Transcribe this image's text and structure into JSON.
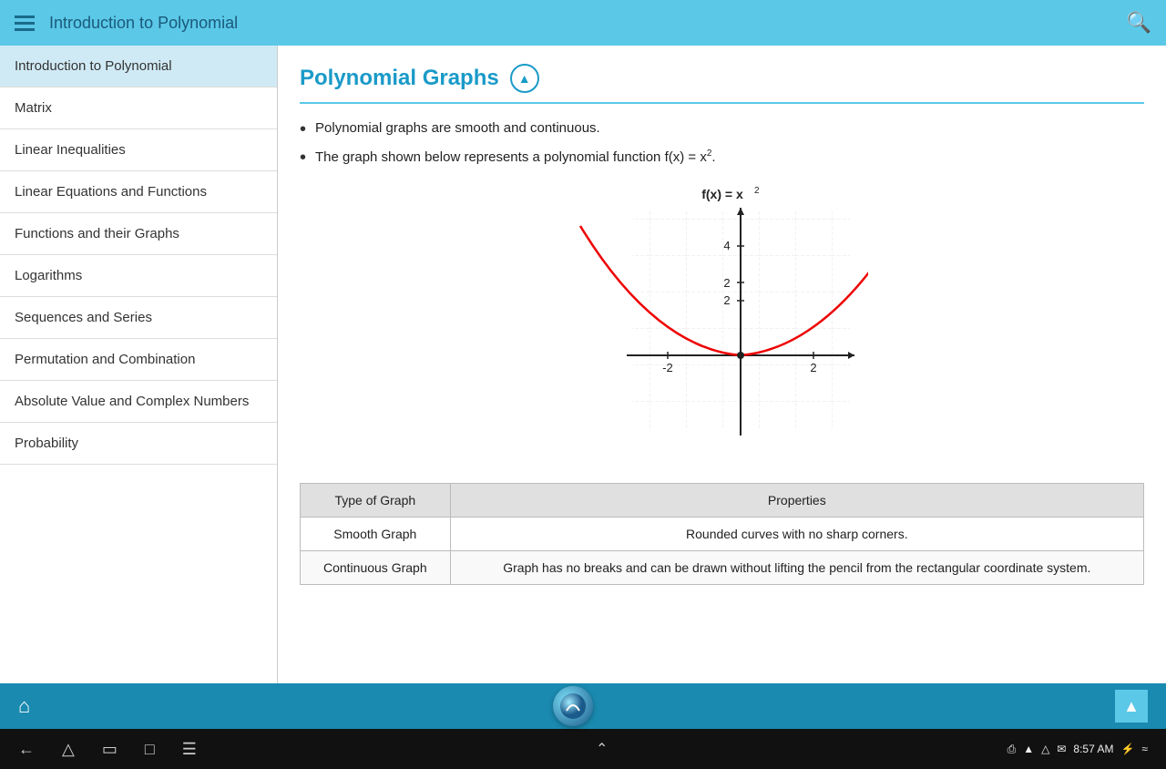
{
  "header": {
    "title": "Introduction to Polynomial",
    "search_icon": "🔍"
  },
  "sidebar": {
    "items": [
      {
        "label": "Introduction to Polynomial",
        "active": true
      },
      {
        "label": "Matrix",
        "active": false
      },
      {
        "label": "Linear Inequalities",
        "active": false
      },
      {
        "label": "Linear Equations and Functions",
        "active": false
      },
      {
        "label": "Functions and their Graphs",
        "active": false
      },
      {
        "label": "Logarithms",
        "active": false
      },
      {
        "label": "Sequences and Series",
        "active": false
      },
      {
        "label": "Permutation and Combination",
        "active": false
      },
      {
        "label": "Absolute Value and Complex Numbers",
        "active": false
      },
      {
        "label": "Probability",
        "active": false
      }
    ]
  },
  "content": {
    "page_title": "Polynomial Graphs",
    "bullets": [
      "Polynomial graphs are smooth and continuous.",
      "The graph shown below represents a polynomial function f(x) = x²."
    ],
    "chart": {
      "title": "f(x) = x²",
      "x_labels": [
        "-2",
        "2"
      ],
      "y_labels": [
        "2",
        "4"
      ]
    },
    "table": {
      "headers": [
        "Type of Graph",
        "Properties"
      ],
      "rows": [
        {
          "type": "Smooth Graph",
          "properties": "Rounded curves with no sharp corners."
        },
        {
          "type": "Continuous Graph",
          "properties": "Graph has no breaks and can be drawn without lifting the pencil from the rectangular coordinate system."
        }
      ]
    }
  },
  "android": {
    "time": "8:57 AM"
  }
}
